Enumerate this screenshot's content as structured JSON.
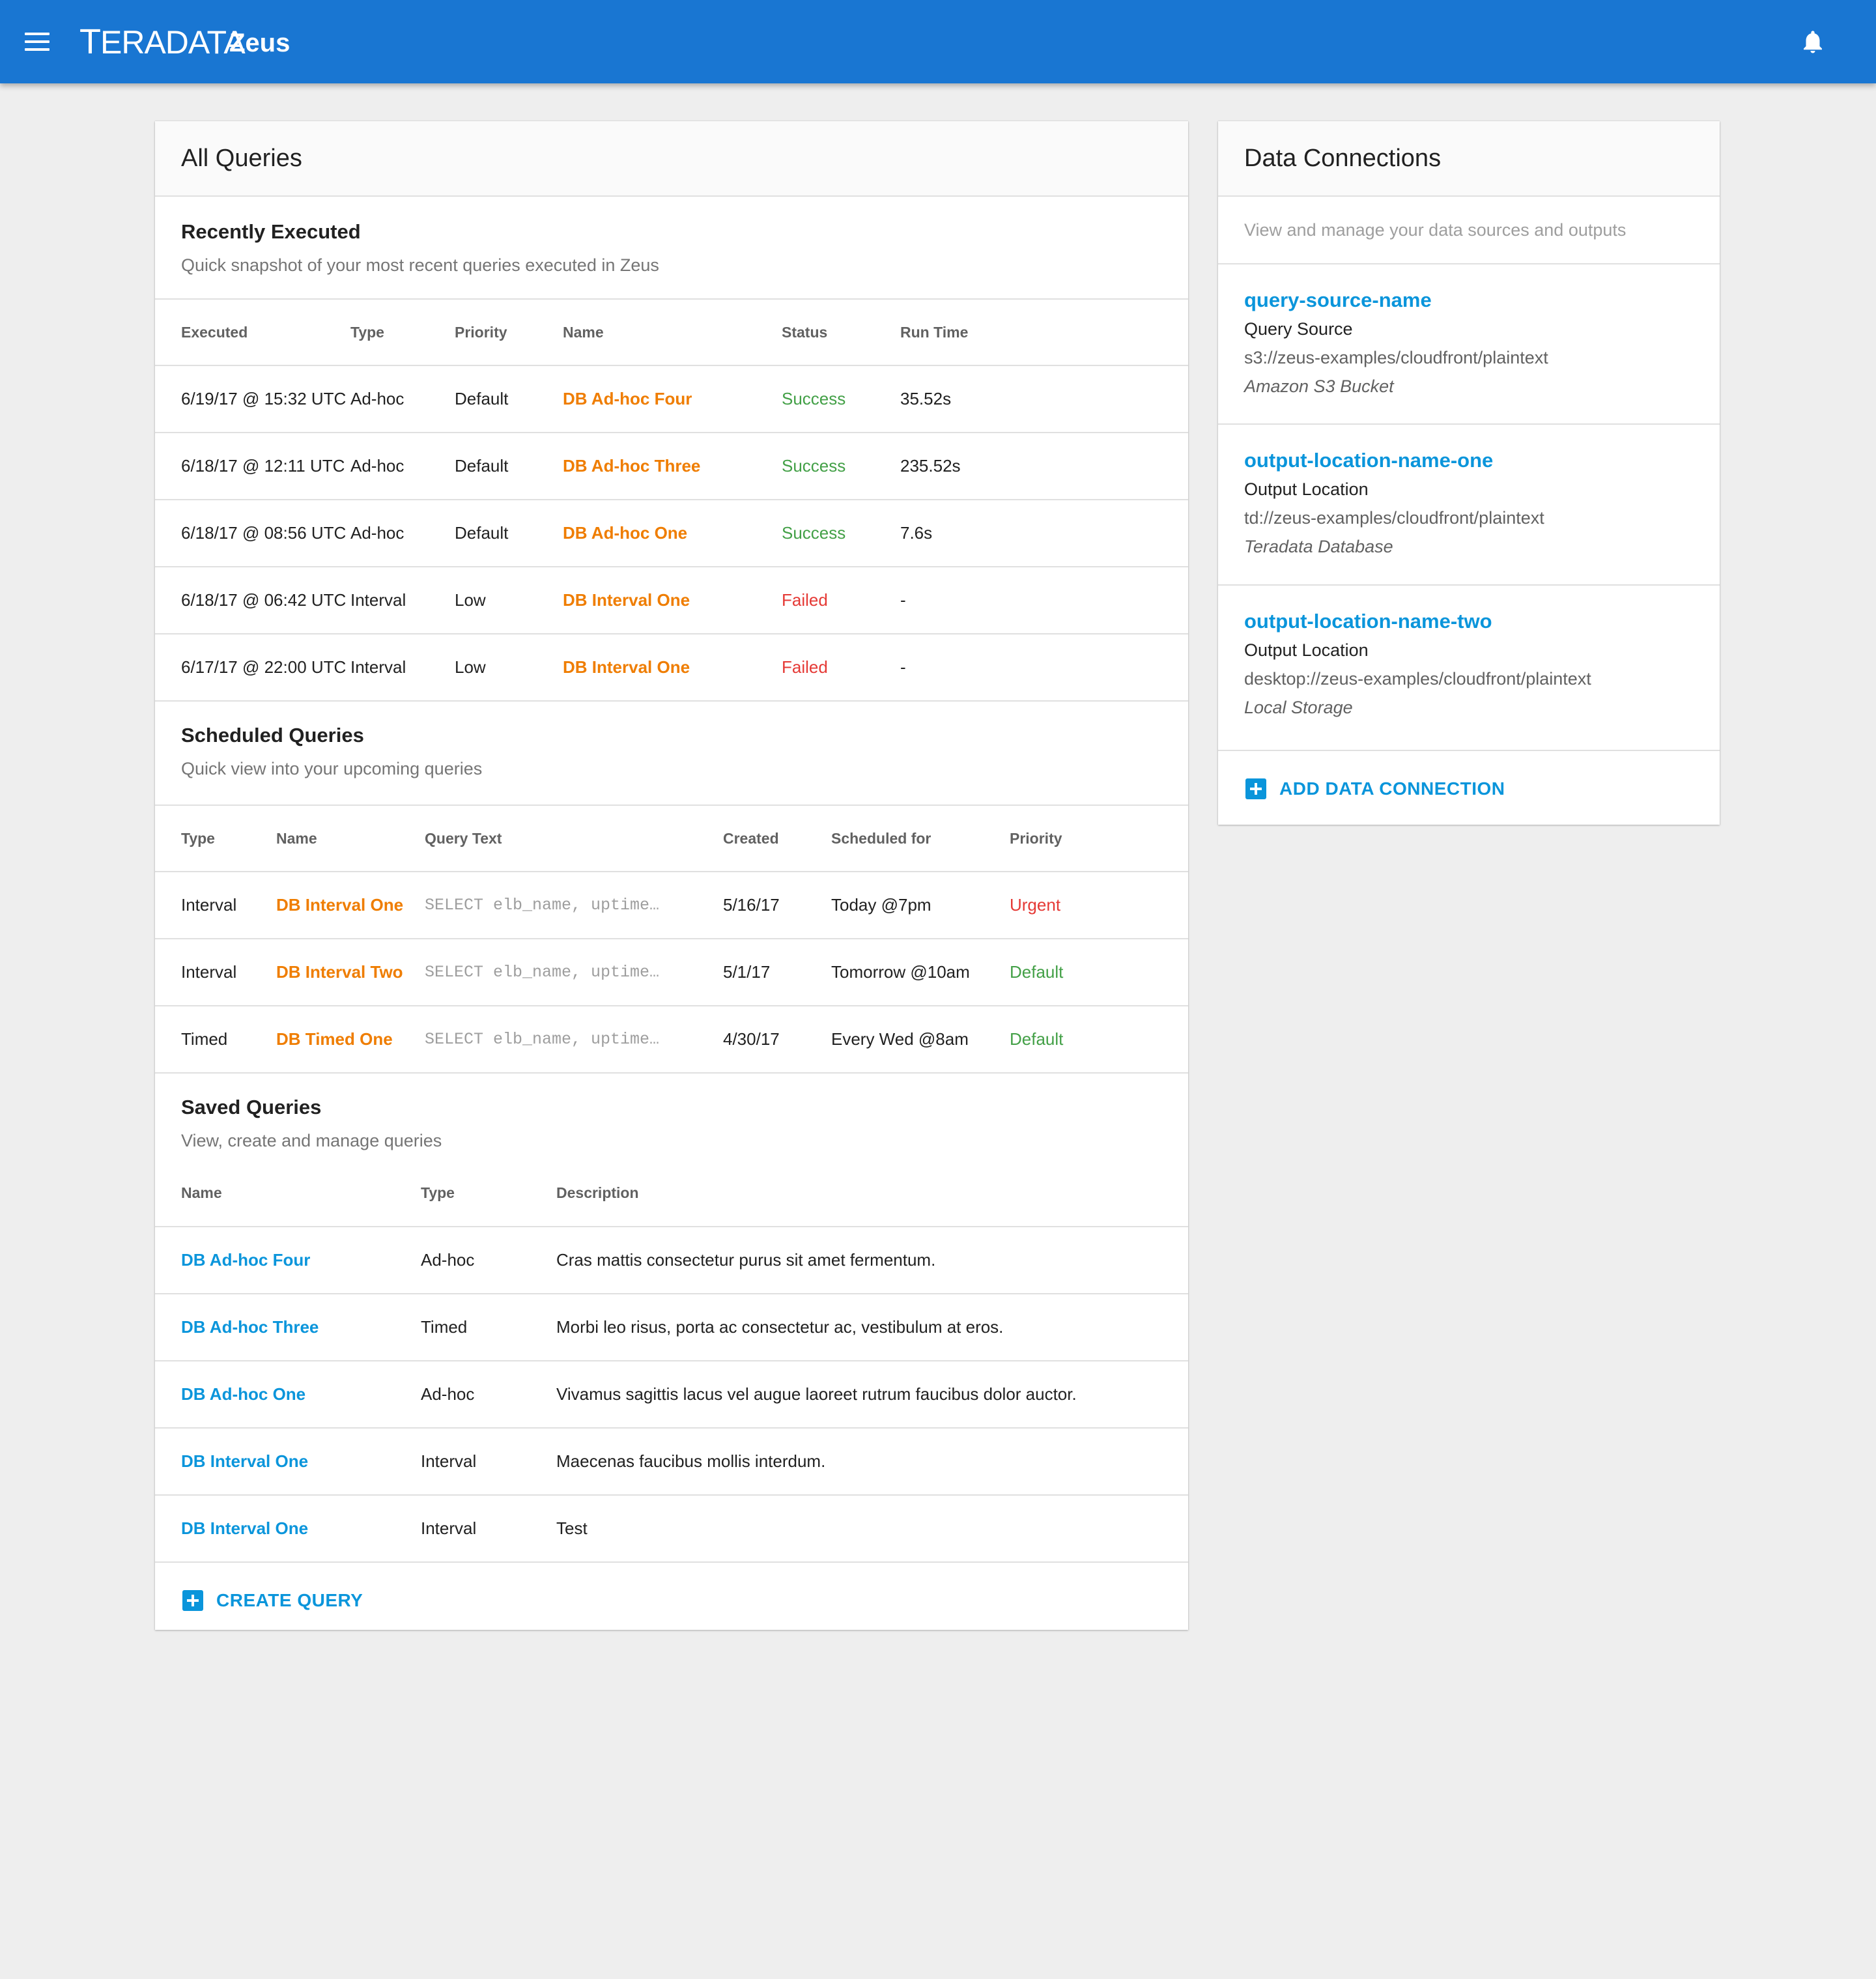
{
  "appbar": {
    "brand_initial": "T",
    "brand_rest": "ERADATA",
    "app_name": "Zeus",
    "menu_icon": "menu-icon",
    "bell_icon": "bell-icon",
    "color": "#1976d2"
  },
  "all_queries": {
    "title": "All Queries",
    "recent": {
      "title": "Recently Executed",
      "subtitle": "Quick snapshot of your most recent queries executed in Zeus",
      "columns": [
        "Executed",
        "Type",
        "Priority",
        "Name",
        "Status",
        "Run Time"
      ],
      "rows": [
        {
          "executed": "6/19/17 @ 15:32 UTC",
          "type": "Ad-hoc",
          "priority": "Default",
          "name": "DB Ad-hoc Four",
          "status": "Success",
          "runtime": "35.52s"
        },
        {
          "executed": "6/18/17 @ 12:11 UTC",
          "type": "Ad-hoc",
          "priority": "Default",
          "name": "DB Ad-hoc Three",
          "status": "Success",
          "runtime": "235.52s"
        },
        {
          "executed": "6/18/17 @ 08:56 UTC",
          "type": "Ad-hoc",
          "priority": "Default",
          "name": "DB Ad-hoc One",
          "status": "Success",
          "runtime": "7.6s"
        },
        {
          "executed": "6/18/17 @ 06:42 UTC",
          "type": "Interval",
          "priority": "Low",
          "name": "DB Interval One",
          "status": "Failed",
          "runtime": "-"
        },
        {
          "executed": "6/17/17 @ 22:00 UTC",
          "type": "Interval",
          "priority": "Low",
          "name": "DB Interval One",
          "status": "Failed",
          "runtime": "-"
        }
      ]
    },
    "scheduled": {
      "title": "Scheduled Queries",
      "subtitle": "Quick view into your upcoming queries",
      "columns": [
        "Type",
        "Name",
        "Query Text",
        "Created",
        "Scheduled for",
        "Priority"
      ],
      "rows": [
        {
          "type": "Interval",
          "name": "DB Interval One",
          "query": "SELECT elb_name, uptime…",
          "created": "5/16/17",
          "scheduled": "Today @7pm",
          "priority": "Urgent"
        },
        {
          "type": "Interval",
          "name": "DB Interval Two",
          "query": "SELECT elb_name, uptime…",
          "created": "5/1/17",
          "scheduled": "Tomorrow @10am",
          "priority": "Default"
        },
        {
          "type": "Timed",
          "name": "DB Timed One",
          "query": "SELECT elb_name, uptime…",
          "created": "4/30/17",
          "scheduled": "Every Wed @8am",
          "priority": "Default"
        }
      ]
    },
    "saved": {
      "title": "Saved Queries",
      "subtitle": "View, create and manage queries",
      "columns": [
        "Name",
        "Type",
        "Description"
      ],
      "rows": [
        {
          "name": "DB Ad-hoc Four",
          "type": "Ad-hoc",
          "description": "Cras mattis consectetur purus sit amet fermentum."
        },
        {
          "name": "DB Ad-hoc Three",
          "type": "Timed",
          "description": "Morbi leo risus, porta ac consectetur ac, vestibulum at eros."
        },
        {
          "name": "DB Ad-hoc One",
          "type": "Ad-hoc",
          "description": "Vivamus sagittis lacus vel augue laoreet rutrum faucibus dolor auctor."
        },
        {
          "name": "DB Interval One",
          "type": "Interval",
          "description": "Maecenas faucibus mollis interdum."
        },
        {
          "name": "DB Interval One",
          "type": "Interval",
          "description": "Test"
        }
      ]
    },
    "create_label": "CREATE QUERY"
  },
  "data_connections": {
    "title": "Data Connections",
    "subtitle": "View and manage your data sources and outputs",
    "items": [
      {
        "name": "query-source-name",
        "type": "Query Source",
        "path": "s3://zeus-examples/cloudfront/plaintext",
        "kind": "Amazon S3 Bucket"
      },
      {
        "name": "output-location-name-one",
        "type": "Output Location",
        "path": "td://zeus-examples/cloudfront/plaintext",
        "kind": "Teradata Database"
      },
      {
        "name": "output-location-name-two",
        "type": "Output Location",
        "path": "desktop://zeus-examples/cloudfront/plaintext",
        "kind": "Local Storage"
      }
    ],
    "add_label": "ADD DATA CONNECTION"
  },
  "colors": {
    "link_orange": "#ef7d00",
    "link_blue": "#0a95db",
    "success": "#43a047",
    "failed": "#e53935"
  }
}
